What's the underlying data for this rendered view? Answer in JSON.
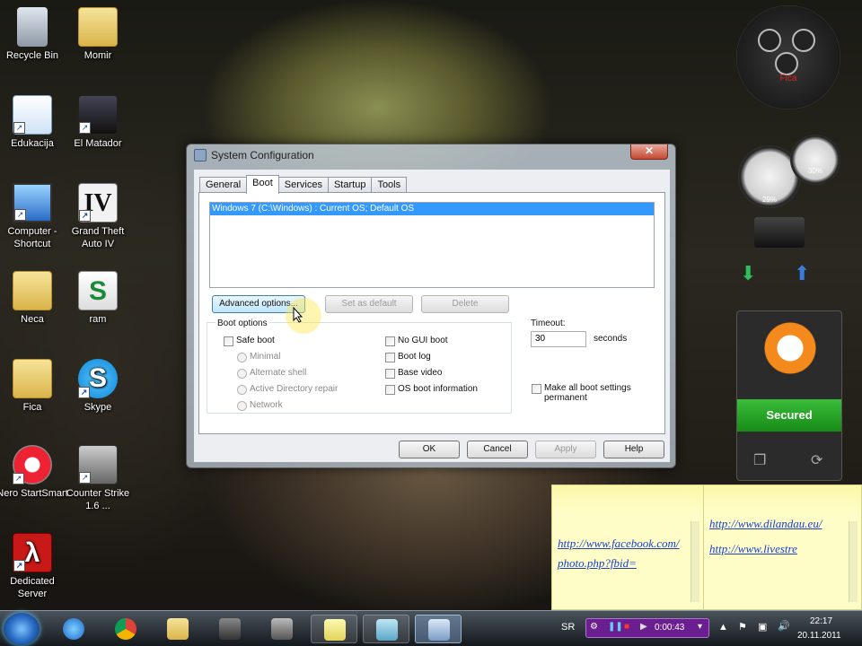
{
  "desktop": {
    "icons": [
      {
        "label": "Recycle Bin"
      },
      {
        "label": "Momir"
      },
      {
        "label": "Edukacija"
      },
      {
        "label": "El Matador"
      },
      {
        "label": "Computer - Shortcut"
      },
      {
        "label": "Grand Theft Auto IV"
      },
      {
        "label": "Neca"
      },
      {
        "label": "ram"
      },
      {
        "label": "Fica"
      },
      {
        "label": "Skype"
      },
      {
        "label": "Nero StartSmart"
      },
      {
        "label": "Counter Strike 1.6 ..."
      },
      {
        "label": "Dedicated Server"
      }
    ]
  },
  "window": {
    "title": "System Configuration",
    "close_glyph": "✕",
    "tabs": [
      "General",
      "Boot",
      "Services",
      "Startup",
      "Tools"
    ],
    "active_tab": "Boot",
    "os_entry": "Windows 7 (C:\\Windows) : Current OS; Default OS",
    "buttons": {
      "advanced": "Advanced options...",
      "set_default": "Set as default",
      "delete": "Delete"
    },
    "boot_options_label": "Boot options",
    "safe_boot": "Safe boot",
    "safe_modes": [
      "Minimal",
      "Alternate shell",
      "Active Directory repair",
      "Network"
    ],
    "right_options": [
      "No GUI boot",
      "Boot log",
      "Base video",
      "OS boot information"
    ],
    "timeout_label": "Timeout:",
    "timeout_value": "30",
    "timeout_unit": "seconds",
    "make_permanent": "Make all boot settings permanent",
    "footer": {
      "ok": "OK",
      "cancel": "Cancel",
      "apply": "Apply",
      "help": "Help"
    }
  },
  "gadgets": {
    "clock_brand": "Fica",
    "cpu_percent": "29%",
    "ram_percent": "30%",
    "avast_status": "Secured"
  },
  "sticky_notes": [
    {
      "links": [
        "http://www.facebook.com/photo.php?fbid="
      ]
    },
    {
      "links": [
        "http://www.dilandau.eu/",
        "http://www.livestre"
      ]
    }
  ],
  "taskbar": {
    "language": "SR",
    "recording_time": "0:00:43",
    "time": "22:17",
    "date": "20.11.2011"
  }
}
